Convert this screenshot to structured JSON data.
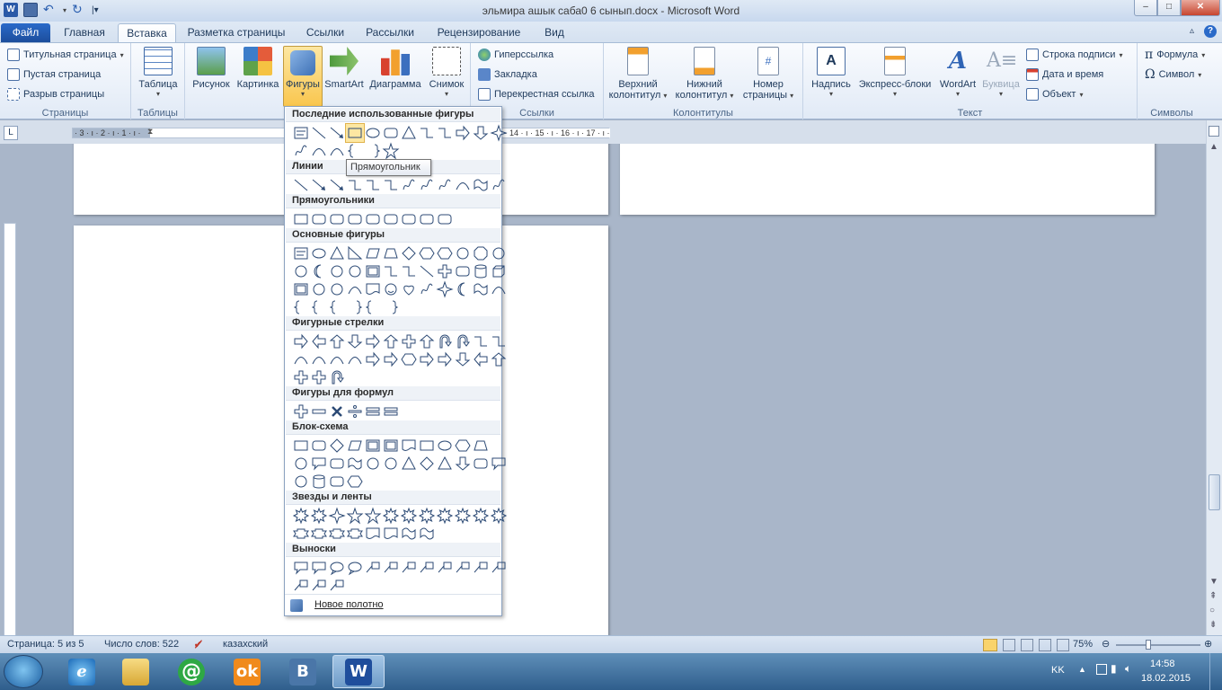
{
  "window": {
    "title": "эльмира ашык саба0 6 сынып.docx - Microsoft Word",
    "minimize": "–",
    "maximize": "□",
    "close": "✕"
  },
  "tabs": [
    {
      "label": "Файл"
    },
    {
      "label": "Главная"
    },
    {
      "label": "Вставка"
    },
    {
      "label": "Разметка страницы"
    },
    {
      "label": "Ссылки"
    },
    {
      "label": "Рассылки"
    },
    {
      "label": "Рецензирование"
    },
    {
      "label": "Вид"
    }
  ],
  "ribbon": {
    "pages": {
      "label": "Страницы",
      "cover": "Титульная страница",
      "blank": "Пустая страница",
      "break": "Разрыв страницы"
    },
    "tables": {
      "label": "Таблицы",
      "table": "Таблица"
    },
    "illustrations": {
      "picture": "Рисунок",
      "clipart": "Картинка",
      "shapes": "Фигуры",
      "smartart": "SmartArt",
      "chart": "Диаграмма",
      "screenshot": "Снимок"
    },
    "links": {
      "label": "Ссылки",
      "hyperlink": "Гиперссылка",
      "bookmark": "Закладка",
      "crossref": "Перекрестная ссылка"
    },
    "headerfooter": {
      "label": "Колонтитулы",
      "header1": "Верхний",
      "header2": "колонтитул",
      "footer1": "Нижний",
      "footer2": "колонтитул",
      "pagenum1": "Номер",
      "pagenum2": "страницы"
    },
    "text": {
      "label": "Текст",
      "textbox": "Надпись",
      "quickparts": "Экспресс-блоки",
      "wordart": "WordArt",
      "dropcap": "Буквица",
      "signature": "Строка подписи",
      "datetime": "Дата и время",
      "object": "Объект"
    },
    "symbols": {
      "label": "Символы",
      "equation": "Формула",
      "symbol": "Символ"
    }
  },
  "shapes_menu": {
    "sections": {
      "recent": "Последние использованные фигуры",
      "lines": "Линии",
      "rectangles": "Прямоугольники",
      "basic": "Основные фигуры",
      "arrows": "Фигурные стрелки",
      "equation": "Фигуры для формул",
      "flowchart": "Блок-схема",
      "stars": "Звезды и ленты",
      "callouts": "Выноски"
    },
    "tooltip": "Прямоугольник",
    "new_canvas": "Новое полотно"
  },
  "ruler": {
    "left_numbers": "· 3 · ı · 2 · ı · 1 · ı ·",
    "right_numbers": "· ı · 14 · ı · 15 · ı · 16 · ı · 17 · ı ·",
    "corner": "L"
  },
  "status": {
    "page": "Страница: 5 из 5",
    "words": "Число слов: 522",
    "language": "казахский",
    "zoom": "75%",
    "zoom_level_percent": 75
  },
  "tray": {
    "lang": "KK",
    "time": "14:58",
    "date": "18.02.2015"
  },
  "colors": {
    "accent": "#2a6ac9",
    "ribbon_bg": "#e1eaf6",
    "doc_bg": "#a9b6c9",
    "shapes_button": "#f9c64e",
    "taskbar": "#2f5e8c"
  },
  "icons": {
    "word": "word-icon",
    "save": "save-icon",
    "undo": "undo-icon",
    "redo": "redo-icon",
    "ie": "internet-explorer-icon",
    "explorer": "folder-icon",
    "mailru": "mail-at-icon",
    "ok": "odnoklassniki-icon",
    "vk": "vk-icon"
  }
}
